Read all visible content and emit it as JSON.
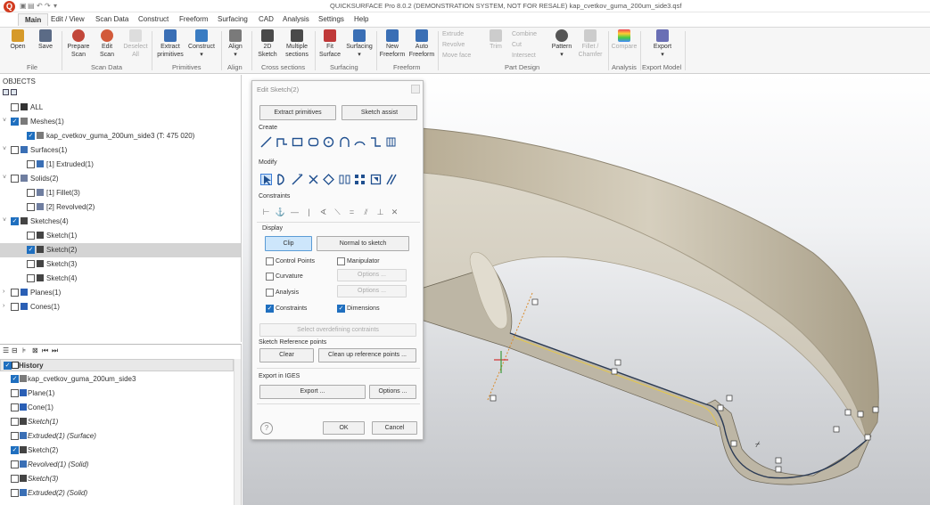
{
  "window": {
    "logo": "Q",
    "title": "QUICKSURFACE Pro 8.0.2 (DEMONSTRATION SYSTEM, NOT FOR RESALE)   kap_cvetkov_guma_200um_side3.qsf"
  },
  "quick_access": [
    "save-icon",
    "undo-icon",
    "redo-icon",
    "dropdown-icon"
  ],
  "menu": [
    "Main",
    "Edit / View",
    "Scan Data",
    "Construct",
    "Freeform",
    "Surfacing",
    "CAD",
    "Analysis",
    "Settings",
    "Help"
  ],
  "ribbon": {
    "buttons": [
      {
        "label": "Open",
        "icon": "folder-open-icon",
        "color": "#d69a2a"
      },
      {
        "label": "Save",
        "icon": "save-disk-icon",
        "color": "#5b6b86"
      },
      {
        "label": "Prepare\nScan",
        "icon": "prepare-scan-icon",
        "color": "#c2473a"
      },
      {
        "label": "Edit\nScan",
        "icon": "edit-scan-icon",
        "color": "#d25a3a"
      },
      {
        "label": "Deselect\nAll",
        "icon": "deselect-icon",
        "color": "#cccccc",
        "disabled": true
      },
      {
        "label": "Extract\nprimitives",
        "icon": "extract-primitives-icon",
        "color": "#3a6fb5"
      },
      {
        "label": "Construct\n▾",
        "icon": "construct-icon",
        "color": "#3a7cc2"
      },
      {
        "label": "Align\n▾",
        "icon": "align-icon",
        "color": "#7a7a7a"
      },
      {
        "label": "2D\nSketch",
        "icon": "sketch-2d-icon",
        "color": "#4a4a4a"
      },
      {
        "label": "Multiple\nsections",
        "icon": "multiple-sections-icon",
        "color": "#4a4a4a"
      },
      {
        "label": "Fit\nSurface",
        "icon": "fit-surface-icon",
        "color": "#c03a3a"
      },
      {
        "label": "Surfacing\n▾",
        "icon": "surfacing-icon",
        "color": "#3a6fb5"
      },
      {
        "label": "New\nFreeform",
        "icon": "new-freeform-icon",
        "color": "#3a6fb5"
      },
      {
        "label": "Auto\nFreeform",
        "icon": "auto-freeform-icon",
        "color": "#3a6fb5"
      },
      {
        "label": "Trim",
        "icon": "trim-icon",
        "color": "#bbbbbb",
        "disabled": true
      },
      {
        "label": "Pattern\n▾",
        "icon": "pattern-icon",
        "color": "#555555"
      },
      {
        "label": "Fillet /\nChamfer",
        "icon": "fillet-icon",
        "color": "#bbbbbb",
        "disabled": true
      },
      {
        "label": "Compare",
        "icon": "compare-icon",
        "color": "#bbbbbb",
        "disabled": true
      },
      {
        "label": "Export\n▾",
        "icon": "export-icon",
        "color": "#6a6fb5"
      }
    ],
    "small_disabled": [
      "Extrude",
      "Revolve",
      "Move face",
      "Combine",
      "Cut",
      "Intersect"
    ],
    "groups": [
      "File",
      "Scan Data",
      "Primitives",
      "Align",
      "Cross sections",
      "Surfacing",
      "Freeform",
      "Part Design",
      "Analysis",
      "Export Model"
    ]
  },
  "objects": {
    "title": "OBJECTS",
    "items": [
      {
        "label": "ALL",
        "level": 0,
        "checked": false,
        "twisty": "",
        "icon": "all-icon"
      },
      {
        "label": "Meshes(1)",
        "level": 0,
        "checked": true,
        "twisty": "˅",
        "icon": "mesh-icon"
      },
      {
        "label": "kap_cvetkov_guma_200um_side3 (T: 475 020)",
        "level": 1,
        "checked": true,
        "twisty": "",
        "icon": "mesh-icon"
      },
      {
        "label": "Surfaces(1)",
        "level": 0,
        "checked": false,
        "twisty": "˅",
        "icon": "surface-icon"
      },
      {
        "label": "[1] Extruded(1)",
        "level": 1,
        "checked": false,
        "twisty": "",
        "icon": "surface-icon"
      },
      {
        "label": "Solids(2)",
        "level": 0,
        "checked": false,
        "twisty": "˅",
        "icon": "solid-icon"
      },
      {
        "label": "[1] Fillet(3)",
        "level": 1,
        "checked": false,
        "twisty": "",
        "icon": "solid-icon"
      },
      {
        "label": "[2] Revolved(2)",
        "level": 1,
        "checked": false,
        "twisty": "",
        "icon": "solid-icon"
      },
      {
        "label": "Sketches(4)",
        "level": 0,
        "checked": true,
        "twisty": "˅",
        "icon": "sketch-icon"
      },
      {
        "label": "Sketch(1)",
        "level": 1,
        "checked": false,
        "twisty": "",
        "icon": "sketch-icon"
      },
      {
        "label": "Sketch(2)",
        "level": 1,
        "checked": true,
        "twisty": "",
        "icon": "sketch-icon",
        "selected": true
      },
      {
        "label": "Sketch(3)",
        "level": 1,
        "checked": false,
        "twisty": "",
        "icon": "sketch-icon"
      },
      {
        "label": "Sketch(4)",
        "level": 1,
        "checked": false,
        "twisty": "",
        "icon": "sketch-icon"
      },
      {
        "label": "Planes(1)",
        "level": 0,
        "checked": false,
        "twisty": "›",
        "icon": "plane-icon"
      },
      {
        "label": "Cones(1)",
        "level": 0,
        "checked": false,
        "twisty": "›",
        "icon": "cone-icon"
      }
    ]
  },
  "history": {
    "title": "History",
    "items": [
      {
        "label": "kap_cvetkov_guma_200um_side3",
        "checked": true,
        "italic": false,
        "icon": "mesh-icon"
      },
      {
        "label": "Plane(1)",
        "checked": false,
        "italic": false,
        "icon": "plane-icon"
      },
      {
        "label": "Cone(1)",
        "checked": false,
        "italic": false,
        "icon": "cone-icon"
      },
      {
        "label": "Sketch(1)",
        "checked": false,
        "italic": true,
        "icon": "sketch-icon"
      },
      {
        "label": "Extruded(1) (Surface)",
        "checked": false,
        "italic": true,
        "icon": "extrude-icon"
      },
      {
        "label": "Sketch(2)",
        "checked": true,
        "italic": false,
        "icon": "sketch-icon"
      },
      {
        "label": "Revolved(1) (Solid)",
        "checked": false,
        "italic": true,
        "icon": "revolve-icon"
      },
      {
        "label": "Sketch(3)",
        "checked": false,
        "italic": true,
        "icon": "sketch-icon"
      },
      {
        "label": "Extruded(2) (Solid)",
        "checked": false,
        "italic": true,
        "icon": "extrude-icon"
      }
    ]
  },
  "dialog": {
    "title": "Edit Sketch(2)",
    "extract_primitives": "Extract primitives",
    "sketch_assist": "Sketch assist",
    "create_label": "Create",
    "create_tools": [
      "line-icon",
      "polyline-icon",
      "rectangle-icon",
      "rounded-rectangle-icon",
      "circle-icon",
      "arc-icon",
      "three-point-arc-icon",
      "slot-icon",
      "offset-icon"
    ],
    "modify_label": "Modify",
    "modify_tools": [
      "select-arrow-icon",
      "trim-modify-icon",
      "extend-icon",
      "cut-icon",
      "move-icon",
      "mirror-icon",
      "pattern-grid-icon",
      "project-icon",
      "offset-curve-icon"
    ],
    "constraints_label": "Constraints",
    "constraint_tools": [
      "horizontal-distance-icon",
      "anchor-icon",
      "horizontal-icon",
      "vertical-icon",
      "angle-icon",
      "coincident-icon",
      "equal-icon",
      "parallel-icon",
      "perpendicular-icon",
      "delete-constraint-icon"
    ],
    "display_label": "Display",
    "clip": "Clip",
    "normal_to_sketch": "Normal to sketch",
    "control_points": "Control Points",
    "manipulator": "Manipulator",
    "curvature": "Curvature",
    "analysis": "Analysis",
    "options_disabled": "Options ...",
    "constraints": "Constraints",
    "dimensions": "Dimensions",
    "select_overdefining": "Select overdefining contraints",
    "sketch_reference_points": "Sketch Reference points",
    "clear": "Clear",
    "clean_up": "Clean up reference points ...",
    "export_label": "Export in IGES",
    "export": "Export ...",
    "options": "Options ...",
    "help": "?",
    "ok": "OK",
    "cancel": "Cancel"
  }
}
